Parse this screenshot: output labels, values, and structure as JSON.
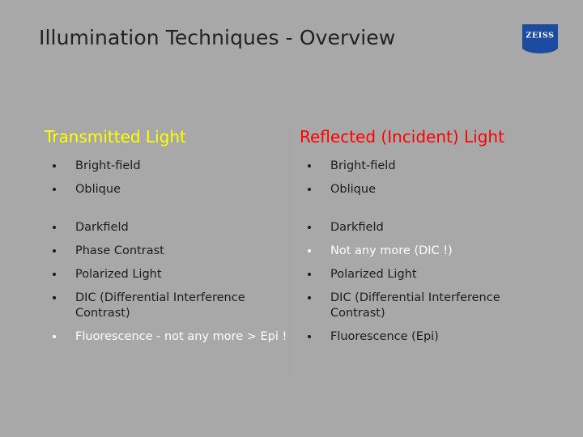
{
  "slide": {
    "title": "Illumination Techniques - Overview",
    "background_color": "#a8a8a8"
  },
  "logo": {
    "name": "ZEISS",
    "wordmark": "ZEISS",
    "background_color": "#1b4ca0",
    "text_color": "#ffffff"
  },
  "columns": [
    {
      "heading": "Transmitted Light",
      "heading_color": "#ffff00",
      "group_one": [
        {
          "label": "Bright-field",
          "color": "#1c1c1c"
        },
        {
          "label": "Oblique",
          "color": "#1c1c1c"
        }
      ],
      "group_two": [
        {
          "label": "Darkfield",
          "color": "#1c1c1c"
        },
        {
          "label": "Phase Contrast",
          "color": "#1c1c1c"
        },
        {
          "label": "Polarized Light",
          "color": "#1c1c1c"
        },
        {
          "label": "DIC (Differential Interference Contrast)",
          "color": "#1c1c1c"
        },
        {
          "label": "Fluorescence - not any more > Epi !",
          "color": "#ffffff"
        }
      ]
    },
    {
      "heading": "Reflected (Incident) Light",
      "heading_color": "#ff0000",
      "group_one": [
        {
          "label": "Bright-field",
          "color": "#1c1c1c"
        },
        {
          "label": "Oblique",
          "color": "#1c1c1c"
        }
      ],
      "group_two": [
        {
          "label": "Darkfield",
          "color": "#1c1c1c"
        },
        {
          "label": "Not any more (DIC !)",
          "color": "#ffffff"
        },
        {
          "label": "Polarized Light",
          "color": "#1c1c1c"
        },
        {
          "label": "DIC (Differential Interference Contrast)",
          "color": "#1c1c1c"
        },
        {
          "label": "Fluorescence (Epi)",
          "color": "#1c1c1c"
        }
      ]
    }
  ]
}
